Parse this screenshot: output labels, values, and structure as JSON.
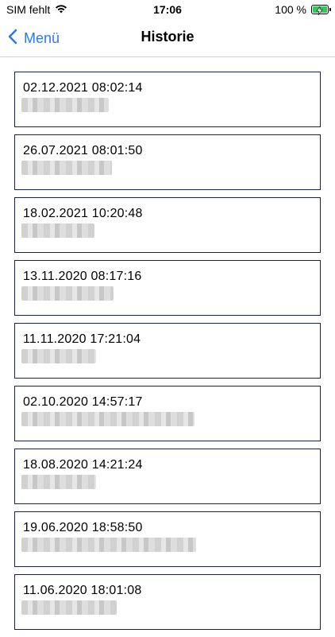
{
  "status_bar": {
    "carrier": "SIM fehlt",
    "time": "17:06",
    "battery": "100 %"
  },
  "nav": {
    "back_label": "Menü",
    "title": "Historie"
  },
  "history": [
    {
      "date": "02.12.2021 08:02:14"
    },
    {
      "date": "26.07.2021 08:01:50"
    },
    {
      "date": "18.02.2021 10:20:48"
    },
    {
      "date": "13.11.2020 08:17:16"
    },
    {
      "date": "11.11.2020 17:21:04"
    },
    {
      "date": "02.10.2020 14:57:17"
    },
    {
      "date": "18.08.2020 14:21:24"
    },
    {
      "date": "19.06.2020 18:58:50"
    },
    {
      "date": "11.06.2020 18:01:08"
    }
  ],
  "colors": {
    "accent": "#2f7ae5",
    "card_border": "#1c2340",
    "battery_fill": "#34c759"
  },
  "icons": {
    "wifi": "wifi-icon",
    "battery": "battery-icon",
    "back": "chevron-left-icon"
  }
}
